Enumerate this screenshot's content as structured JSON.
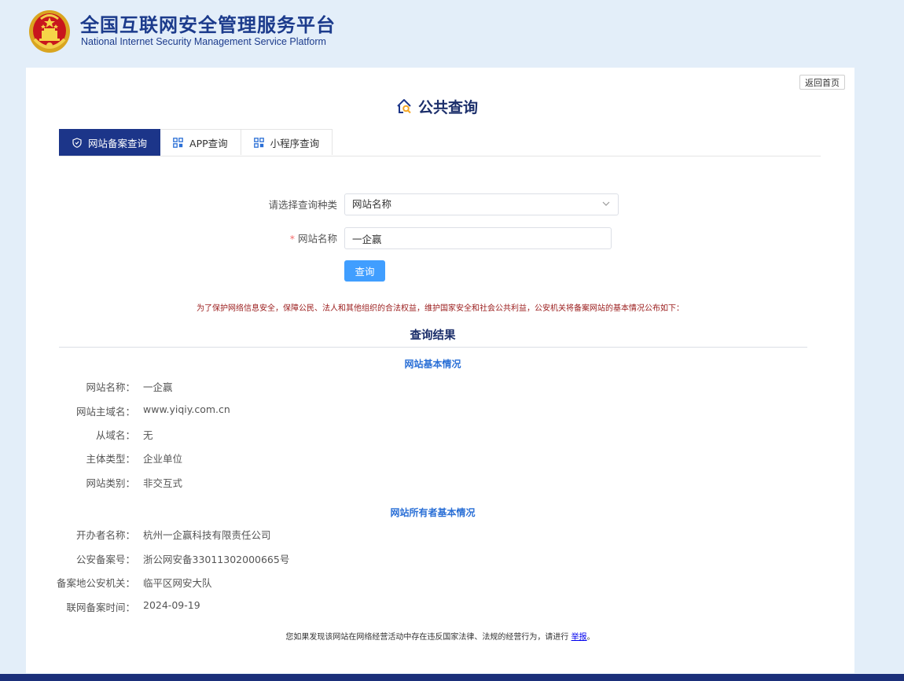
{
  "header": {
    "title": "全国互联网安全管理服务平台",
    "subtitle": "National Internet Security Management Service Platform"
  },
  "nav": {
    "back_home": "返回首页"
  },
  "page": {
    "heading": "公共查询"
  },
  "tabs": [
    {
      "label": "网站备案查询",
      "icon": "shield-icon",
      "active": true
    },
    {
      "label": "APP查询",
      "icon": "grid-icon",
      "active": false
    },
    {
      "label": "小程序查询",
      "icon": "grid-icon",
      "active": false
    }
  ],
  "form": {
    "type_label": "请选择查询种类",
    "type_value": "网站名称",
    "name_label": "网站名称",
    "name_value": "一企赢",
    "required_mark": "*",
    "submit_label": "查询"
  },
  "notice": "为了保护网络信息安全，保障公民、法人和其他组织的合法权益，维护国家安全和社会公共利益，公安机关将备案网站的基本情况公布如下：",
  "result": {
    "title": "查询结果",
    "site_section": {
      "title": "网站基本情况",
      "rows": [
        {
          "label": "网站名称：",
          "value": "一企赢"
        },
        {
          "label": "网站主域名：",
          "value": "www.yiqiy.com.cn"
        },
        {
          "label": "从域名：",
          "value": "无"
        },
        {
          "label": "主体类型：",
          "value": "企业单位"
        },
        {
          "label": "网站类别：",
          "value": "非交互式"
        }
      ]
    },
    "owner_section": {
      "title": "网站所有者基本情况",
      "rows": [
        {
          "label": "开办者名称：",
          "value": "杭州一企赢科技有限责任公司"
        },
        {
          "label": "公安备案号：",
          "value": "浙公网安备33011302000665号"
        },
        {
          "label": "备案地公安机关：",
          "value": "临平区网安大队"
        },
        {
          "label": "联网备案时间：",
          "value": "2024-09-19"
        }
      ]
    }
  },
  "footer": {
    "text": "您如果发现该网站在网络经营活动中存在违反国家法律、法规的经营行为，请进行",
    "link": "举报",
    "end": "。"
  },
  "colors": {
    "brand_navy": "#1c3589",
    "accent_blue": "#409eff",
    "section_blue": "#2a6fd6",
    "notice_red": "#9a1b1b",
    "page_bg": "#e3eef9"
  }
}
